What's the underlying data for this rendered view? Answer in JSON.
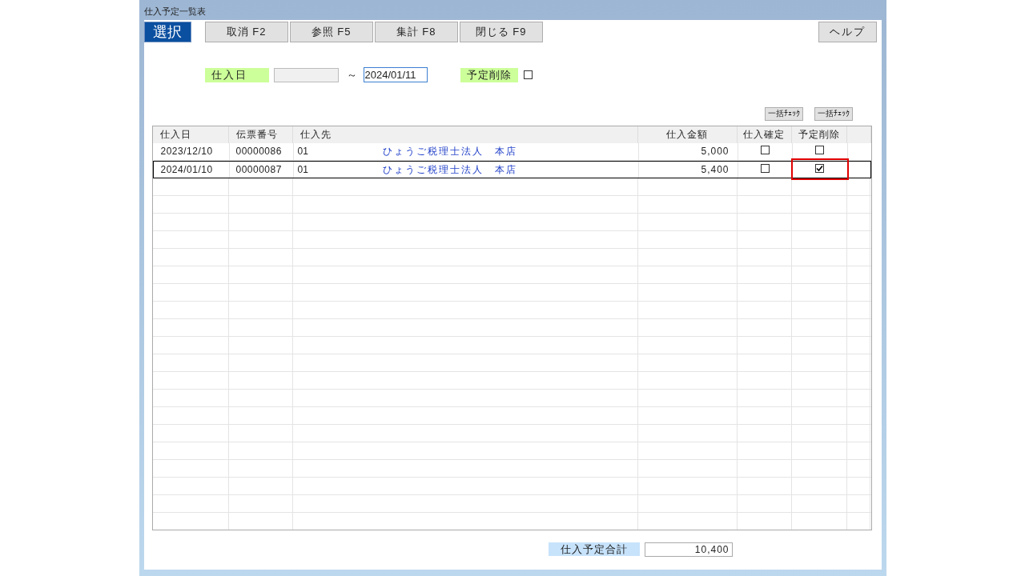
{
  "window": {
    "title": "仕入予定一覧表"
  },
  "toolbar": [
    {
      "label": "選択",
      "selected": true
    },
    {
      "label": "取消 F2",
      "selected": false
    },
    {
      "label": "参照 F5",
      "selected": false
    },
    {
      "label": "集計 F8",
      "selected": false
    },
    {
      "label": "閉じる F9",
      "selected": false
    }
  ],
  "help_button": "ヘルプ",
  "filter": {
    "date_label": "仕入日",
    "range_sep": "～",
    "date_to": "2024/01/11",
    "delete_label": "予定削除",
    "delete_checked": false
  },
  "bulk_buttons": [
    "一括ﾁｪｯｸ",
    "一括ﾁｪｯｸ"
  ],
  "table": {
    "columns": [
      "仕入日",
      "伝票番号",
      "仕入先",
      "仕入金額",
      "仕入確定",
      "予定削除"
    ],
    "rows": [
      {
        "date": "2023/12/10",
        "slip_no": "00000086",
        "supplier_code": "01",
        "supplier_name": "ひょうご税理士法人　本店",
        "amount": "5,000",
        "confirmed": false,
        "delete": false,
        "selected": false,
        "highlighted": false
      },
      {
        "date": "2024/01/10",
        "slip_no": "00000087",
        "supplier_code": "01",
        "supplier_name": "ひょうご税理士法人　本店",
        "amount": "5,400",
        "confirmed": false,
        "delete": true,
        "selected": true,
        "highlighted": true
      }
    ]
  },
  "total": {
    "label": "仕入予定合計",
    "value": "10,400"
  }
}
